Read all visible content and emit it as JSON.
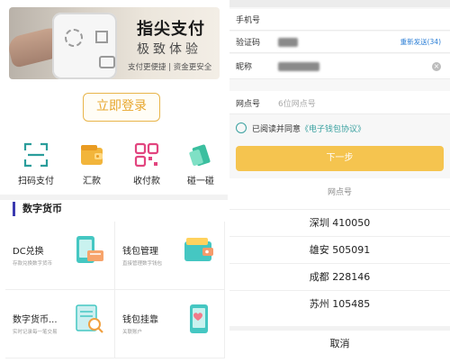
{
  "left": {
    "banner": {
      "title": "指尖支付",
      "subtitle": "极致体验",
      "tagline": "支付更便捷 | 资金更安全"
    },
    "login_label": "立即登录",
    "quick_actions": [
      {
        "label": "扫码支付",
        "icon": "scan-icon"
      },
      {
        "label": "汇款",
        "icon": "wallet-icon"
      },
      {
        "label": "收付款",
        "icon": "qr-code-icon"
      },
      {
        "label": "碰一碰",
        "icon": "tap-card-icon"
      }
    ],
    "section_title": "数字货币",
    "services": [
      {
        "title": "DC兑换",
        "desc": "存款兑换数字货币",
        "icon": "phone-exchange-icon"
      },
      {
        "title": "钱包管理",
        "desc": "直接管理数字钱包",
        "icon": "wallet-card-icon"
      },
      {
        "title": "数字货币...",
        "desc": "实时记录每一笔交易",
        "icon": "document-search-icon"
      },
      {
        "title": "钱包挂靠",
        "desc": "关联账户",
        "icon": "phone-heart-icon"
      }
    ]
  },
  "right": {
    "form": {
      "phone_label": "手机号",
      "code_label": "验证码",
      "resend_label": "重新发送(34)",
      "nickname_label": "昵称",
      "branch_label": "网点号",
      "branch_placeholder": "6位网点号"
    },
    "agreement": {
      "prefix": "已阅读并同意",
      "link": "《电子钱包协议》"
    },
    "next_label": "下一步",
    "sheet": {
      "title": "网点号",
      "options": [
        "深圳 410050",
        "雄安 505091",
        "成都 228146",
        "苏州 105485"
      ],
      "cancel_label": "取消"
    }
  }
}
